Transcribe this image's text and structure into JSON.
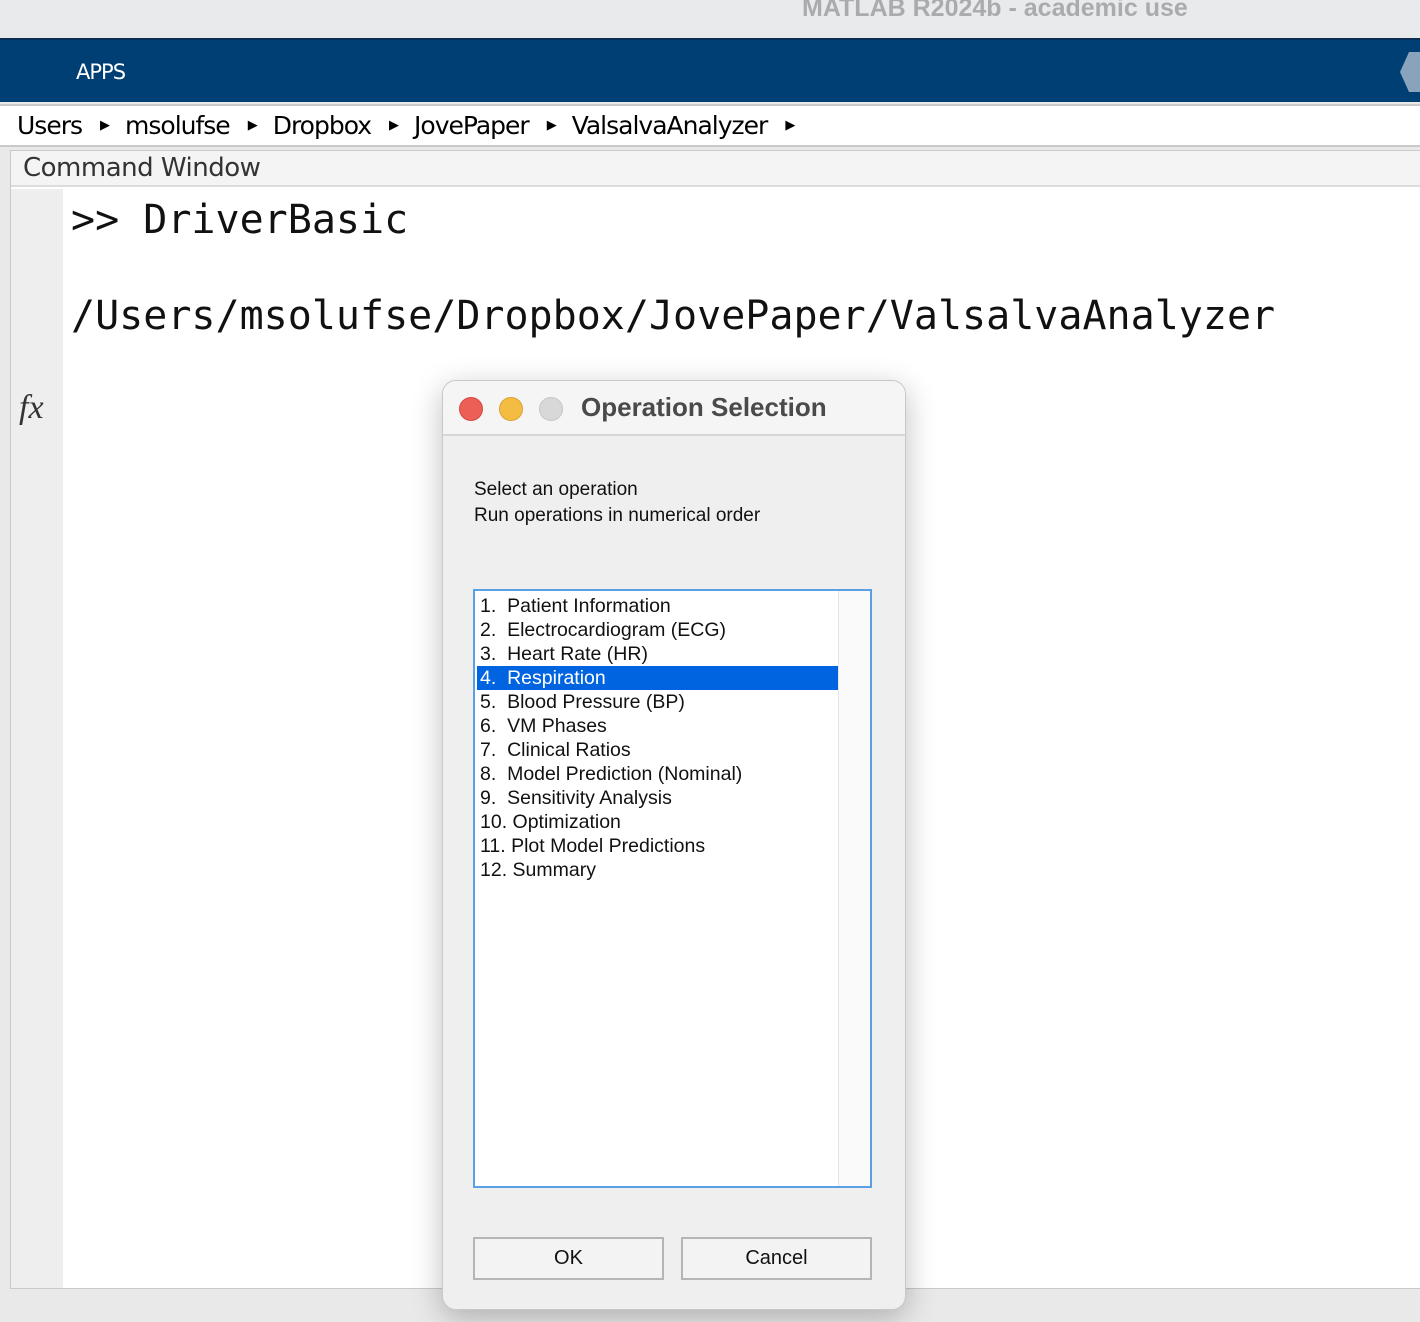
{
  "window": {
    "title": "MATLAB R2024b - academic use"
  },
  "toolbar": {
    "apps_label": "APPS"
  },
  "breadcrumb": [
    "Users",
    "msolufse",
    "Dropbox",
    "JovePaper",
    "ValsalvaAnalyzer"
  ],
  "command_window": {
    "title": "Command Window",
    "command": ">> DriverBasic",
    "output": "/Users/msolufse/Dropbox/JovePaper/ValsalvaAnalyzer",
    "fx_label": "fx"
  },
  "dialog": {
    "title": "Operation Selection",
    "prompt_line1": "Select an operation",
    "prompt_line2": "Run operations in numerical order",
    "items": [
      "1.  Patient Information",
      "2.  Electrocardiogram (ECG)",
      "3.  Heart Rate (HR)",
      "4.  Respiration",
      "5.  Blood Pressure (BP)",
      "6.  VM Phases",
      "7.  Clinical Ratios",
      "8.  Model Prediction (Nominal)",
      "9.  Sensitivity Analysis",
      "10. Optimization",
      "11. Plot Model Predictions",
      "12. Summary"
    ],
    "selected_index": 3,
    "ok_label": "OK",
    "cancel_label": "Cancel"
  },
  "colors": {
    "toolbar": "#003f73",
    "selection": "#0064e1",
    "close": "#ec5f57",
    "minimize": "#f4bd42",
    "zoom_disabled": "#d8d8d8"
  }
}
